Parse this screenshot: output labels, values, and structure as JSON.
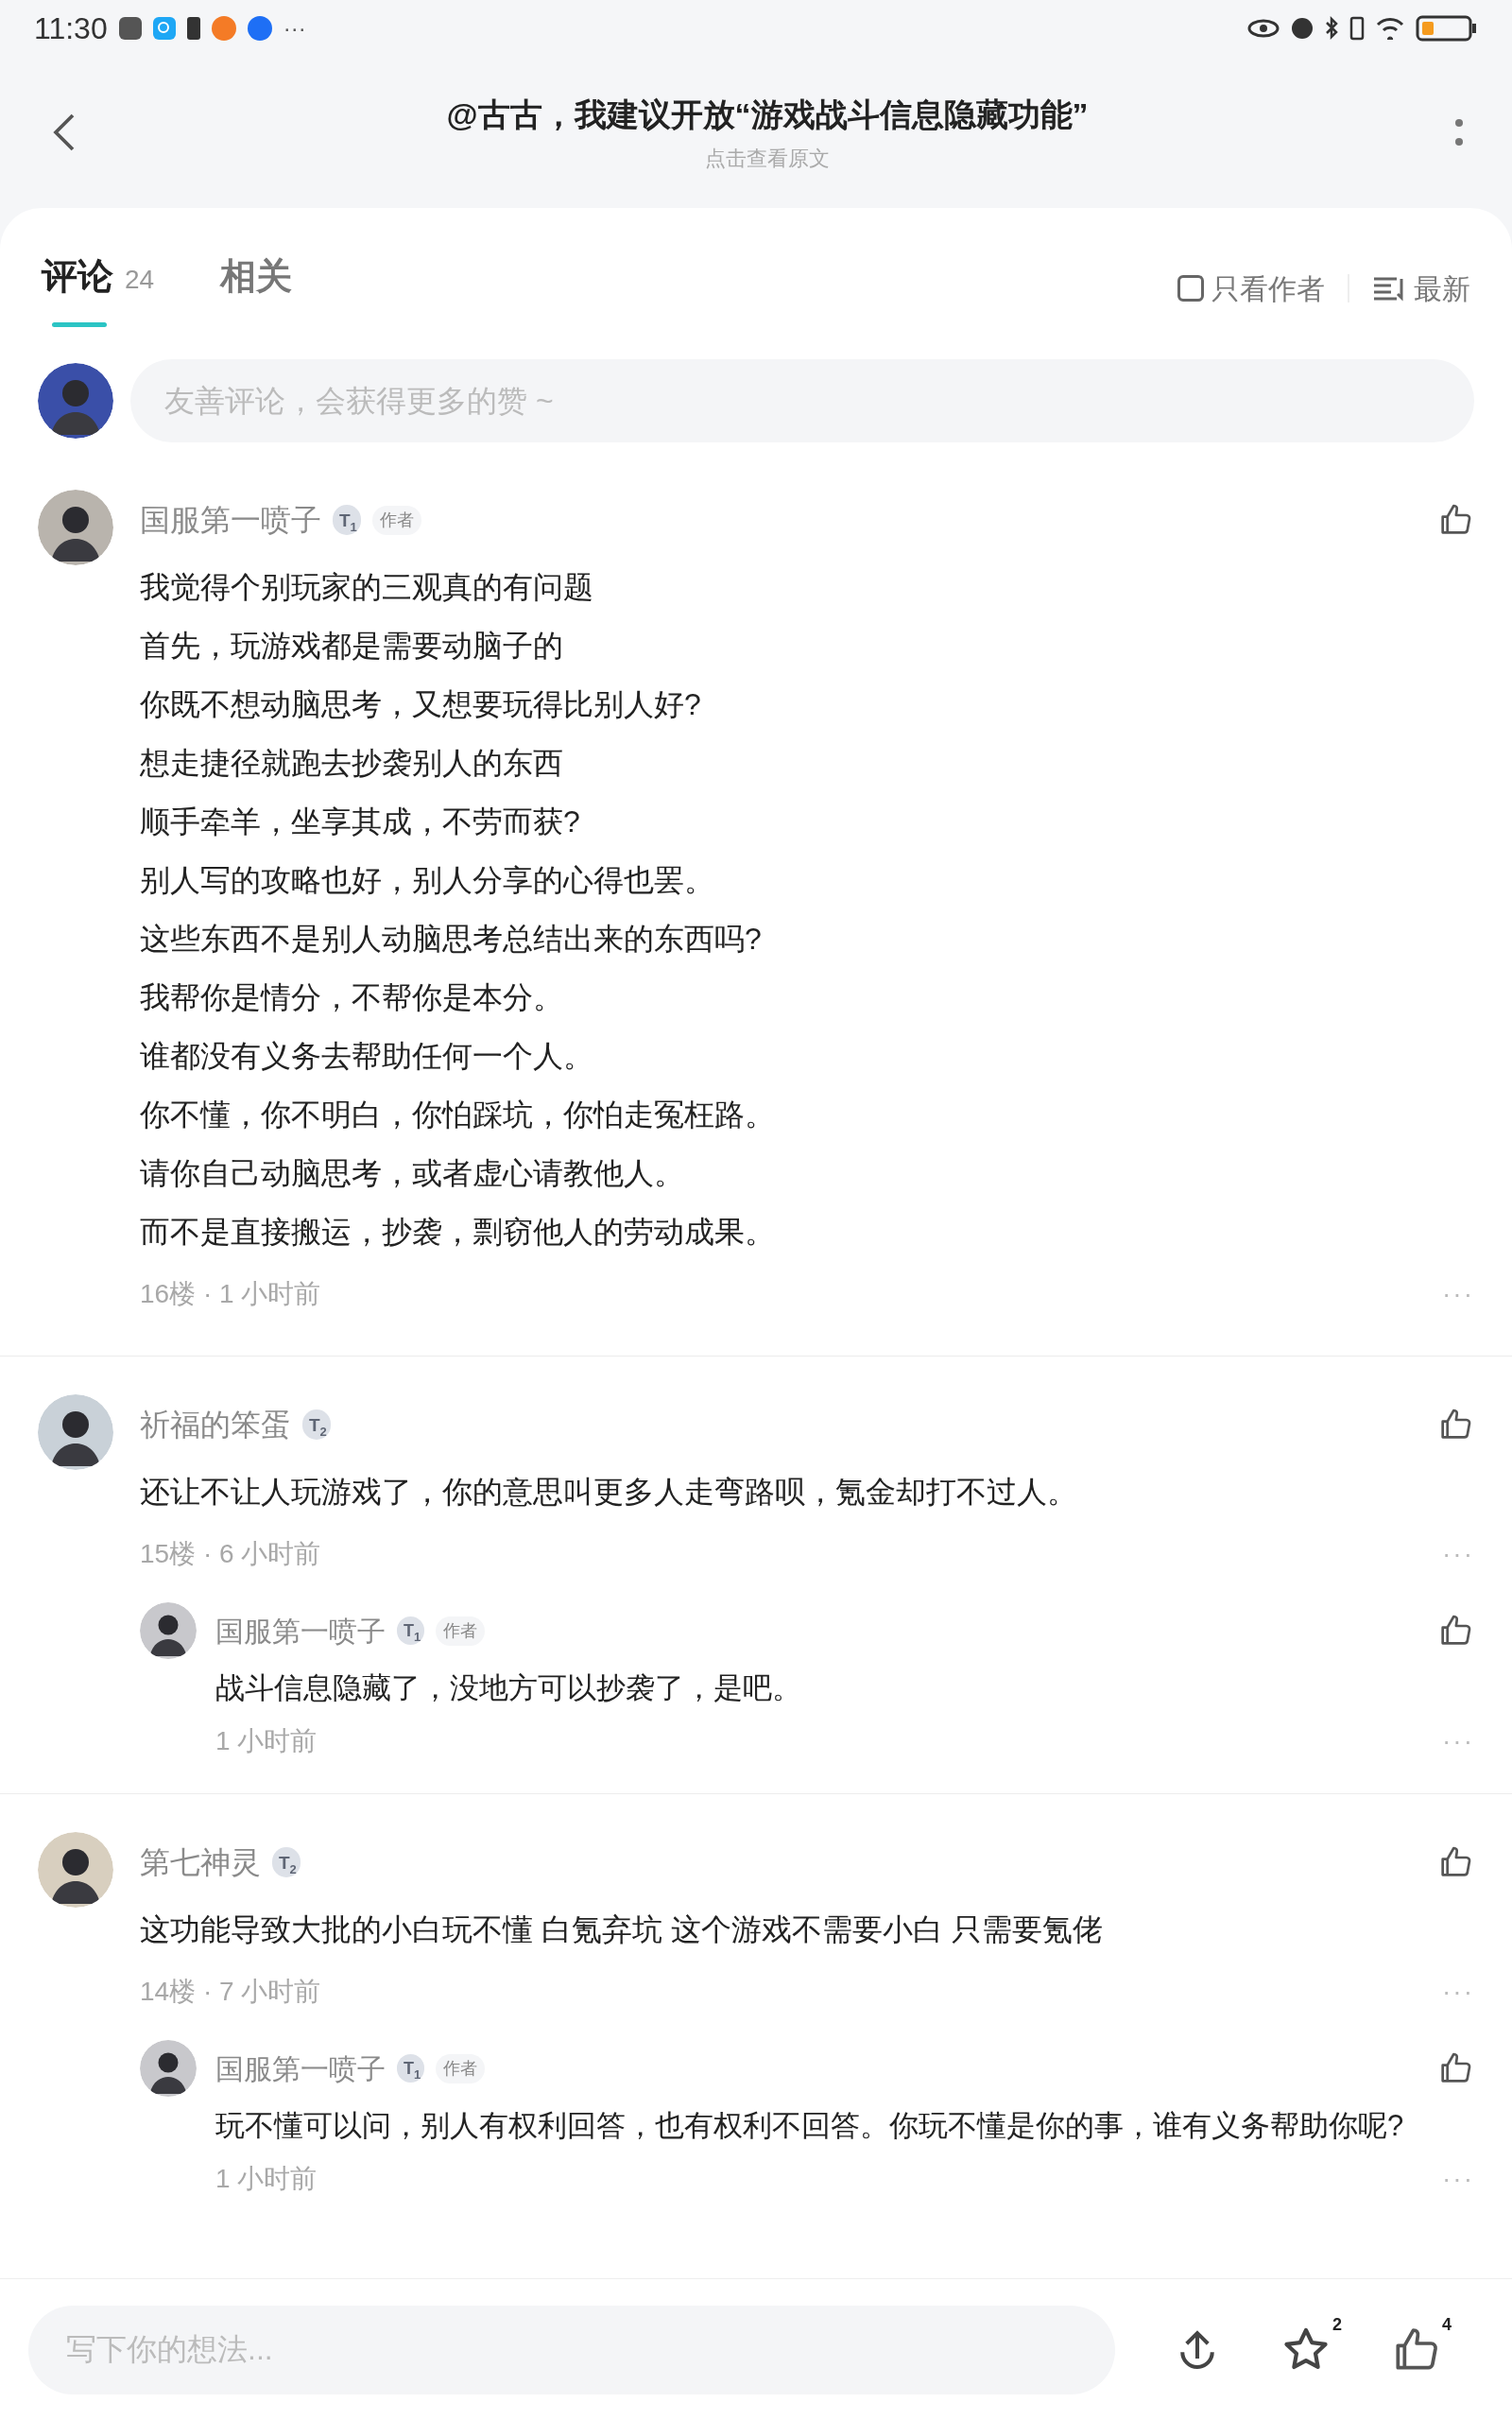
{
  "status_bar": {
    "time": "11:30",
    "more": "···"
  },
  "header": {
    "title": "@古古，我建议开放“游戏战斗信息隐藏功能”",
    "subtitle": "点击查看原文"
  },
  "tabs": [
    {
      "label": "评论",
      "count": "24",
      "selected": true
    },
    {
      "label": "相关",
      "selected": false
    }
  ],
  "filters": {
    "author_only": {
      "label": "只看作者",
      "checked": false
    },
    "sort": {
      "label": "最新"
    }
  },
  "comment_input": {
    "placeholder": "友善评论，会获得更多的赞 ~"
  },
  "comments": [
    {
      "author": "国服第一喷子",
      "badge": "T",
      "rank": "1",
      "tag": "作者",
      "lines": [
        "我觉得个别玩家的三观真的有问题",
        "首先，玩游戏都是需要动脑子的",
        "你既不想动脑思考，又想要玩得比别人好?",
        "想走捷径就跑去抄袭别人的东西",
        "顺手牵羊，坐享其成，不劳而获?",
        "别人写的攻略也好，别人分享的心得也罢。",
        "这些东西不是别人动脑思考总结出来的东西吗?",
        "我帮你是情分，不帮你是本分。",
        "谁都没有义务去帮助任何一个人。",
        "你不懂，你不明白，你怕踩坑，你怕走冤枉路。",
        "请你自己动脑思考，或者虚心请教他人。",
        "而不是直接搬运，抄袭，剽窃他人的劳动成果。"
      ],
      "meta": "16楼 · 1 小时前",
      "more": "···"
    },
    {
      "author": "祈福的笨蛋",
      "badge": "T",
      "rank": "2",
      "lines": [
        "还让不让人玩游戏了，你的意思叫更多人走弯路呗，氪金却打不过人。"
      ],
      "meta": "15楼 · 6 小时前",
      "more": "···",
      "replies": [
        {
          "author": "国服第一喷子",
          "badge": "T",
          "rank": "1",
          "tag": "作者",
          "text": "战斗信息隐藏了，没地方可以抄袭了，是吧。",
          "time": "1 小时前",
          "more": "···"
        }
      ]
    },
    {
      "author": "第七神灵",
      "badge": "T",
      "rank": "2",
      "lines": [
        "这功能导致大批的小白玩不懂 白氪弃坑 这个游戏不需要小白 只需要氪佬"
      ],
      "meta": "14楼 · 7 小时前",
      "more": "···",
      "replies": [
        {
          "author": "国服第一喷子",
          "badge": "T",
          "rank": "1",
          "tag": "作者",
          "text": "玩不懂可以问，别人有权利回答，也有权利不回答。你玩不懂是你的事，谁有义务帮助你呢?",
          "time": "1 小时前",
          "more": "···"
        }
      ]
    }
  ],
  "bottom_bar": {
    "placeholder": "写下你的想法...",
    "favorite_count": "2",
    "like_count": "4"
  }
}
